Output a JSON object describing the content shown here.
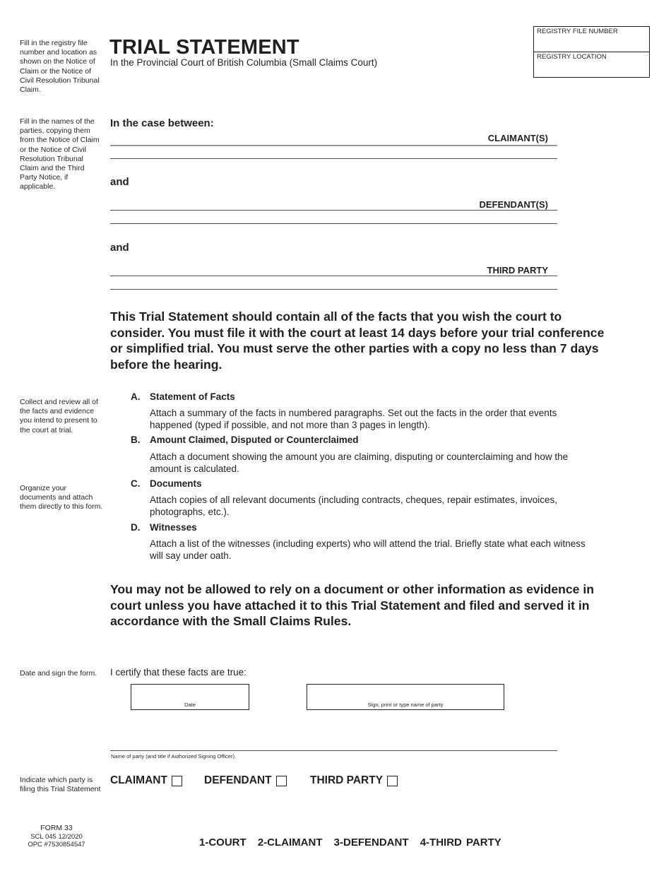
{
  "header": {
    "title": "TRIAL STATEMENT",
    "subtitle": "In the Provincial Court of British Columbia (Small Claims Court)",
    "registry_file_number_label": "REGISTRY FILE NUMBER",
    "registry_file_number_value": "",
    "registry_location_label": "REGISTRY LOCATION",
    "registry_location_value": ""
  },
  "side_notes": {
    "registry": "Fill in the registry file number and location as shown on the Notice of Claim or the Notice of Civil Resolution Tribunal Claim.",
    "parties": "Fill in the names of the parties, copying them from the Notice of Claim or the Notice of Civil Resolution Tribunal Claim and the Third Party Notice, if applicable.",
    "collect": "Collect and review all of the facts and evidence you intend to present to the court at trial.",
    "organize": "Organize your documents and attach them directly to this form.",
    "sign": "Date and sign the form.",
    "indicate": "Indicate which party is filing this Trial Statement"
  },
  "parties": {
    "heading": "In the case between:",
    "and_1": "and",
    "and_2": "and",
    "claimant_label": "CLAIMANT(S)",
    "defendant_label": "DEFENDANT(S)",
    "third_party_label": "THIRD PARTY",
    "claimant_value": "",
    "defendant_value": "",
    "third_party_value": ""
  },
  "instructions_paragraph": "This Trial Statement should contain all of the facts that you wish the court to consider. You must file it with the court at least 14 days before your trial conference or simplified trial. You must serve the other parties with a copy no less than 7 days before the hearing.",
  "items": [
    {
      "letter": "A.",
      "title": "Statement of Facts",
      "body": "Attach a summary of the facts in numbered paragraphs.  Set out the facts in the order that events happened (typed if possible, and not more than 3 pages in length)."
    },
    {
      "letter": "B.",
      "title": "Amount Claimed, Disputed or Counterclaimed",
      "body": "Attach a document showing the amount you are claiming, disputing or counterclaiming and how the amount is calculated."
    },
    {
      "letter": "C.",
      "title": "Documents",
      "body": "Attach copies of all relevant documents (including contracts, cheques, repair estimates, invoices, photographs, etc.)."
    },
    {
      "letter": "D.",
      "title": "Witnesses",
      "body": "Attach a list of the witnesses (including experts) who will attend the trial.  Briefly state what each witness will say under oath."
    }
  ],
  "warning_paragraph": "You may not be allowed to rely on a document or other information as evidence in court unless you have attached it to this Trial Statement and filed and served it in accordance with the Small Claims Rules.",
  "signature": {
    "certify_text": "I certify that these facts are true:",
    "date_caption": "Date",
    "sign_caption": "Sign, print or type name of party",
    "name_caption": "Name of party (and title if Authorized Signing Officer)."
  },
  "filing_party": {
    "options": [
      {
        "label": "CLAIMANT",
        "checked": false
      },
      {
        "label": "DEFENDANT",
        "checked": false
      },
      {
        "label": "THIRD PARTY",
        "checked": false
      }
    ]
  },
  "footer": {
    "form_number": "FORM 33",
    "form_code": "SCL 045   12/2020",
    "opc_number": "OPC #7530854547",
    "copies": [
      "1-COURT",
      "2-CLAIMANT",
      "3-DEFENDANT",
      "4-THIRD PARTY"
    ]
  }
}
